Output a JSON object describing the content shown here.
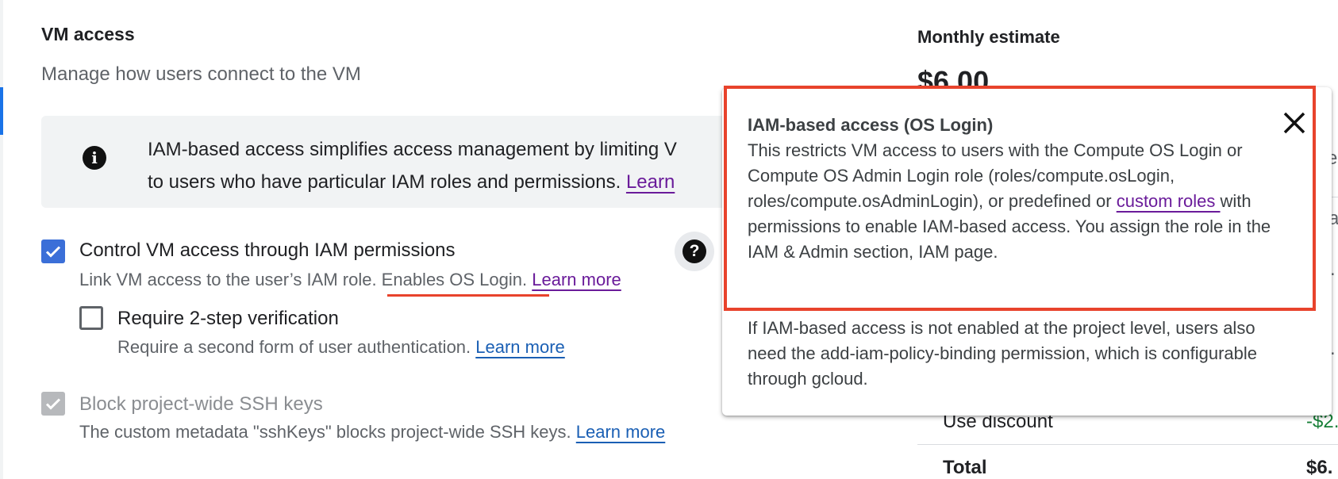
{
  "vm_access": {
    "title": "VM access",
    "subtitle": "Manage how users connect to the VM",
    "info_banner": {
      "line1": "IAM-based access simplifies access management by limiting V",
      "line2": "to users who have particular IAM roles and permissions. ",
      "link": "Learn"
    },
    "options": [
      {
        "label": "Control VM access through IAM permissions",
        "checked": true,
        "desc_part1": "Link VM access to the user’s IAM role. Enables OS Login. ",
        "desc_link": "Learn more"
      },
      {
        "label": "Require 2-step verification",
        "checked": false,
        "desc_part1": "Require a second form of user authentication. ",
        "desc_link": "Learn more"
      },
      {
        "label": "Block project-wide SSH keys",
        "checked": true,
        "disabled": true,
        "desc_part1": "The custom metadata \"sshKeys\" blocks project-wide SSH keys. ",
        "desc_link": "Learn more"
      }
    ],
    "help_icon": "question-mark-icon"
  },
  "estimate": {
    "title": "Monthly estimate",
    "price": "$6.00",
    "rows": [
      {
        "label": "Use discount",
        "value": "-$2."
      },
      {
        "label": "Total",
        "value": "$6."
      }
    ],
    "partial_chars": [
      "e",
      "a",
      ".",
      "."
    ]
  },
  "tooltip": {
    "title": "IAM-based access (OS Login)",
    "para1_part1": "This restricts VM access to users with the Compute OS Login or Compute OS Admin Login role (roles/compute.osLogin, roles/compute.osAdminLogin), or predefined or ",
    "para1_link": "custom roles ",
    "para1_part2": "with permissions to enable IAM-based access. You assign the role in the IAM & Admin section, IAM page.",
    "para2": "If IAM-based access is not enabled at the project level, users also need the add-iam-policy-binding permission, which is configurable through gcloud.",
    "close_icon": "close-icon"
  },
  "colors": {
    "accent_blue": "#3b6fd8",
    "link_purple": "#6a1b9a",
    "link_blue": "#1a5fb4",
    "annotation_red": "#e8432c",
    "discount_green": "#188038"
  }
}
